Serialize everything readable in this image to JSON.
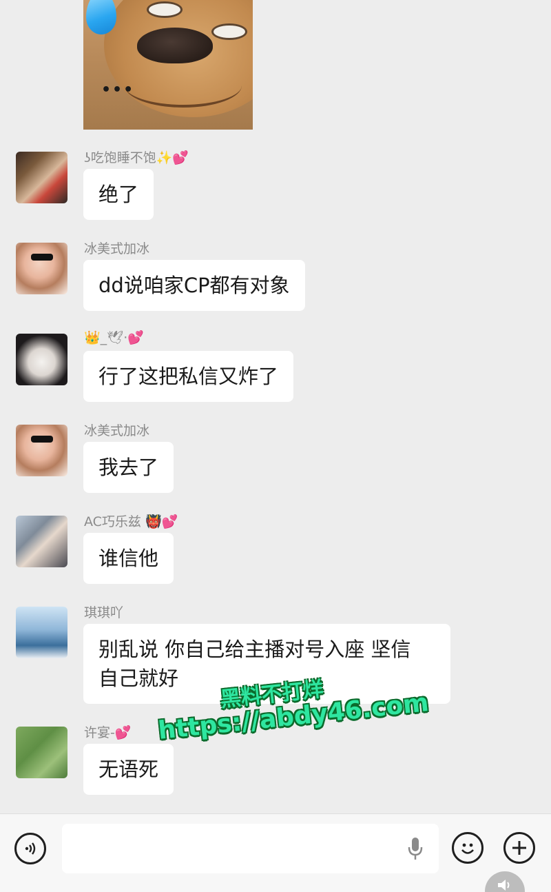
{
  "sticker": {
    "caption": "•••"
  },
  "messages": [
    {
      "sender": "吃饱睡不饱",
      "nick_prefix": "ʖ",
      "nick_suffix": "✨💕",
      "text": "绝了"
    },
    {
      "sender": "冰美式加冰",
      "nick_prefix": "",
      "nick_suffix": "",
      "text": "dd说咱家CP都有对象"
    },
    {
      "sender": "_🕊·",
      "nick_prefix": "👑",
      "nick_suffix": "💕",
      "text": "行了这把私信又炸了"
    },
    {
      "sender": "冰美式加冰",
      "nick_prefix": "",
      "nick_suffix": "",
      "text": "我去了"
    },
    {
      "sender": "AC巧乐兹",
      "nick_prefix": "",
      "nick_suffix": "👹💕",
      "text": "谁信他"
    },
    {
      "sender": "琪琪吖",
      "nick_prefix": "",
      "nick_suffix": "",
      "text_lines": [
        "别乱说 你自己给主播对号入座 坚信",
        "自己就好"
      ]
    },
    {
      "sender": "许宴-",
      "nick_prefix": "",
      "nick_suffix": "💕",
      "text": "无语死"
    }
  ],
  "watermark": {
    "line1": "黑料不打烊",
    "line2": "https://abdy46.com"
  },
  "input_bar": {
    "placeholder": ""
  },
  "colors": {
    "background": "#ededed",
    "bubble": "#ffffff",
    "nickname": "#8a8a8a",
    "watermark": "#2ee6a0"
  }
}
